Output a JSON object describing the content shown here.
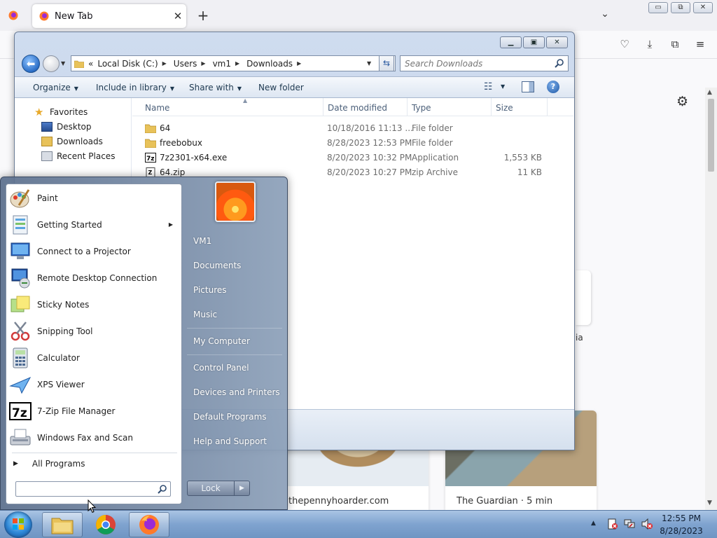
{
  "firefox": {
    "tab_title": "New Tab",
    "new_tab_label": "+",
    "window_buttons": [
      "▭",
      "⧉",
      "✕"
    ],
    "right_card_label": "ia",
    "stories": [
      {
        "source": "thepennyhoarder.com"
      },
      {
        "source": "The Guardian · 5 min"
      }
    ]
  },
  "explorer": {
    "address": {
      "overflow": "«",
      "crumbs": [
        "Local Disk (C:)",
        "Users",
        "vm1",
        "Downloads"
      ]
    },
    "search_placeholder": "Search Downloads",
    "toolbar": {
      "organize": "Organize",
      "include": "Include in library",
      "share": "Share with",
      "new_folder": "New folder"
    },
    "nav": {
      "favorites": "Favorites",
      "desktop": "Desktop",
      "downloads": "Downloads",
      "recent": "Recent Places"
    },
    "columns": {
      "name": "Name",
      "date": "Date modified",
      "type": "Type",
      "size": "Size"
    },
    "files": [
      {
        "name": "64",
        "date": "10/18/2016 11:13 ...",
        "type": "File folder",
        "size": "",
        "icon": "folder-icon"
      },
      {
        "name": "freebobux",
        "date": "8/28/2023 12:53 PM",
        "type": "File folder",
        "size": "",
        "icon": "folder-icon"
      },
      {
        "name": "7z2301-x64.exe",
        "date": "8/20/2023 10:32 PM",
        "type": "Application",
        "size": "1,553 KB",
        "icon": "7zip-exe-icon"
      },
      {
        "name": "64.zip",
        "date": "8/20/2023 10:27 PM",
        "type": "zip Archive",
        "size": "11 KB",
        "icon": "zip-archive-icon"
      }
    ]
  },
  "startmenu": {
    "programs": [
      {
        "label": "Paint",
        "icon": "paint-icon"
      },
      {
        "label": "Getting Started",
        "icon": "getting-started-icon",
        "submenu": true
      },
      {
        "label": "Connect to a Projector",
        "icon": "projector-icon"
      },
      {
        "label": "Remote Desktop Connection",
        "icon": "remote-desktop-icon"
      },
      {
        "label": "Sticky Notes",
        "icon": "sticky-notes-icon"
      },
      {
        "label": "Snipping Tool",
        "icon": "snipping-tool-icon"
      },
      {
        "label": "Calculator",
        "icon": "calculator-icon"
      },
      {
        "label": "XPS Viewer",
        "icon": "xps-viewer-icon"
      },
      {
        "label": "7-Zip File Manager",
        "icon": "7zip-icon"
      },
      {
        "label": "Windows Fax and Scan",
        "icon": "fax-scan-icon"
      }
    ],
    "all_programs": "All Programs",
    "right": {
      "user": "VM1",
      "documents": "Documents",
      "pictures": "Pictures",
      "music": "Music",
      "computer": "My Computer",
      "control_panel": "Control Panel",
      "devices": "Devices and Printers",
      "defaults": "Default Programs",
      "help": "Help and Support"
    },
    "lock_label": "Lock"
  },
  "taskbar": {
    "time": "12:55 PM",
    "date": "8/28/2023"
  },
  "colors": {
    "explorer_frame": "#c7d6ec",
    "startmenu_frame": "#6f829f",
    "taskbar": "#7fa3cf",
    "firefox_bg": "#f9f9fb"
  }
}
